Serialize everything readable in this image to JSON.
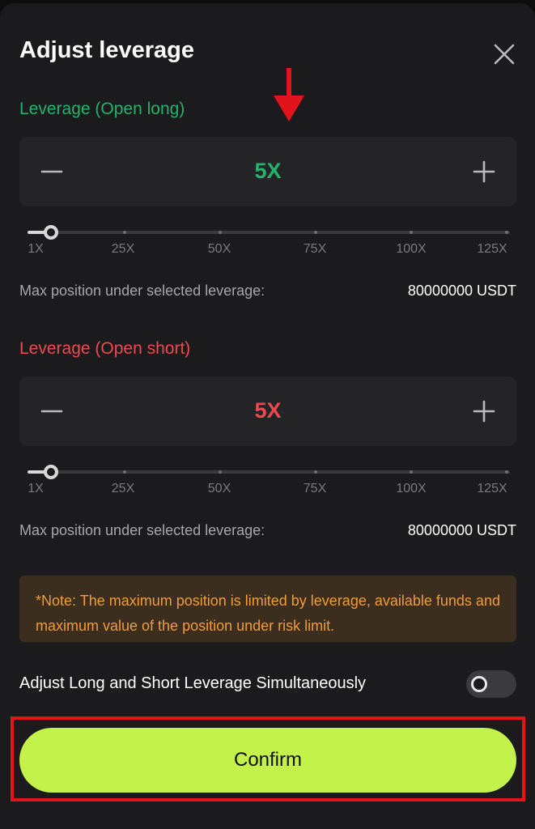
{
  "dialog": {
    "title": "Adjust leverage"
  },
  "long": {
    "label": "Leverage (Open long)",
    "value": "5X",
    "color": "#1fb56a",
    "slider_value": 5,
    "ticks": [
      "1X",
      "25X",
      "50X",
      "75X",
      "100X",
      "125X"
    ],
    "max_label": "Max position under selected leverage:",
    "max_value": "80000000 USDT"
  },
  "short": {
    "label": "Leverage (Open short)",
    "value": "5X",
    "color": "#f0484d",
    "slider_value": 5,
    "ticks": [
      "1X",
      "25X",
      "50X",
      "75X",
      "100X",
      "125X"
    ],
    "max_label": "Max position under selected leverage:",
    "max_value": "80000000 USDT"
  },
  "note": {
    "text": "*Note: The maximum position is limited by leverage, available funds and maximum value of the position under risk limit."
  },
  "simultaneous": {
    "label": "Adjust Long and Short Leverage Simultaneously",
    "enabled": false
  },
  "confirm": {
    "label": "Confirm"
  },
  "colors": {
    "accent_confirm": "#c3f24a",
    "note_text": "#f39b34",
    "highlight_box": "#e1141c",
    "annotation_arrow": "#e1141c"
  },
  "icons": {
    "close": "close-icon",
    "minus": "minus-icon",
    "plus": "plus-icon",
    "arrow": "arrow-down-icon"
  }
}
